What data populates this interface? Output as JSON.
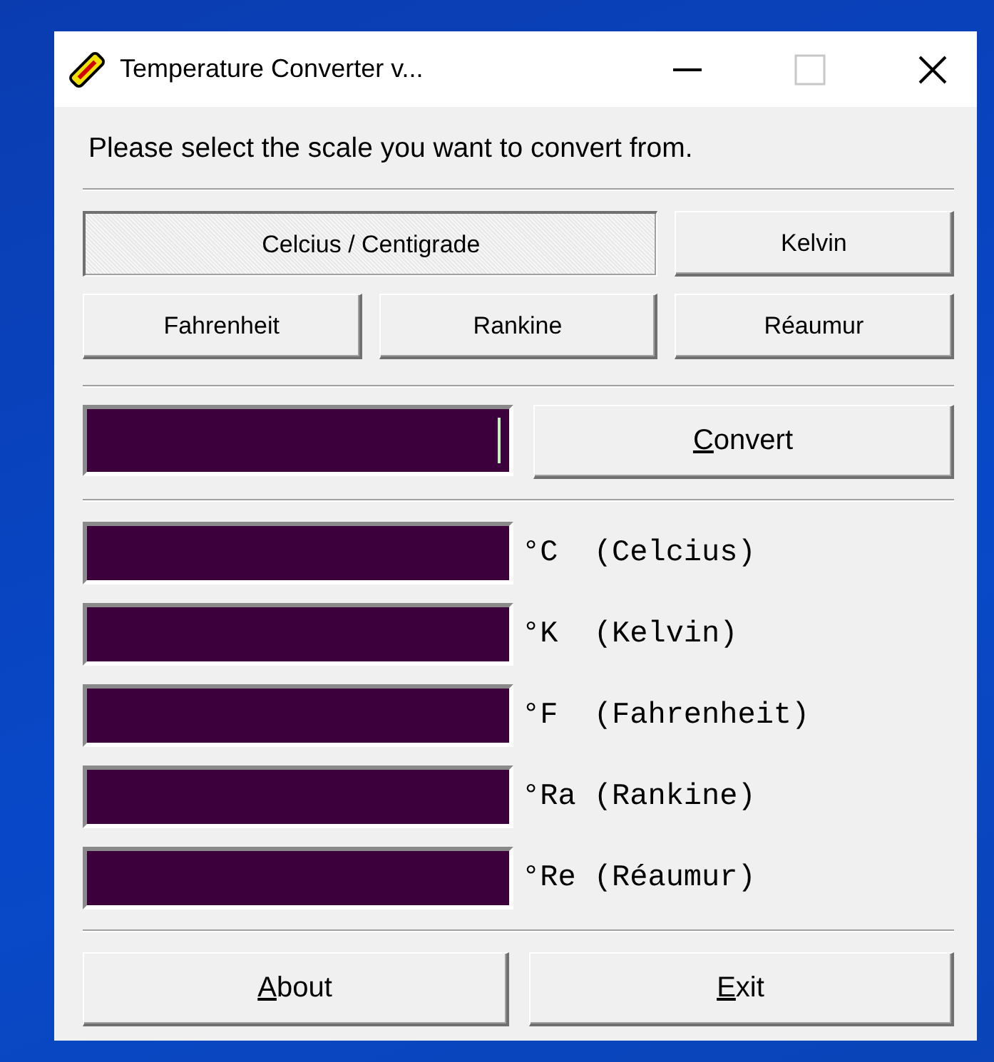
{
  "window": {
    "title": "Temperature Converter v..."
  },
  "prompt": "Please select the scale you want to convert from.",
  "scales": [
    {
      "label": "Celcius  /  Centigrade",
      "selected": true,
      "wide": true
    },
    {
      "label": "Kelvin",
      "selected": false,
      "wide": false
    },
    {
      "label": "Fahrenheit",
      "selected": false,
      "wide": false
    },
    {
      "label": "Rankine",
      "selected": false,
      "wide": false
    },
    {
      "label": "Réaumur",
      "selected": false,
      "wide": false
    }
  ],
  "input": {
    "focused": true
  },
  "convert_button": {
    "label": "Convert",
    "mnemonic": true
  },
  "outputs": [
    {
      "unit": "°C  (Celcius)"
    },
    {
      "unit": "°K  (Kelvin)"
    },
    {
      "unit": "°F  (Fahrenheit)"
    },
    {
      "unit": "°Ra (Rankine)"
    },
    {
      "unit": "°Re (Réaumur)"
    }
  ],
  "buttons": [
    {
      "label": "About",
      "mnemonic": true
    },
    {
      "label": "Exit",
      "mnemonic": true
    }
  ]
}
